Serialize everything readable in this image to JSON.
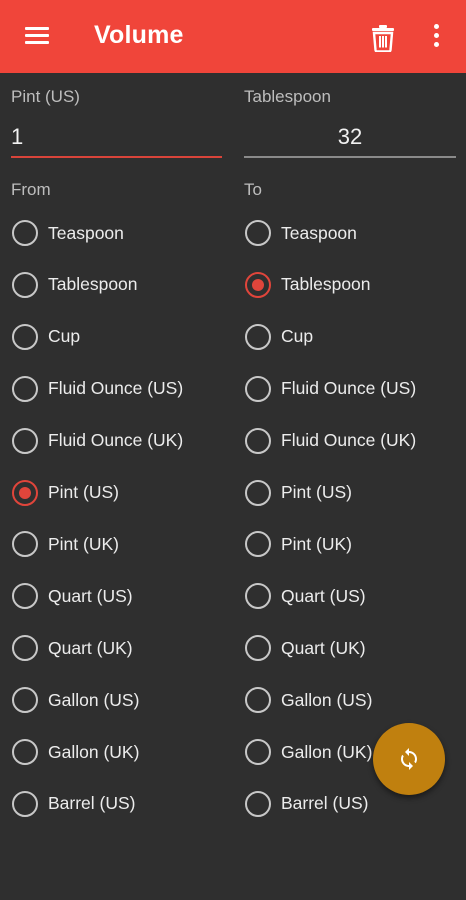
{
  "appbar": {
    "title": "Volume",
    "menu_icon": "menu-icon",
    "delete_icon": "trash-icon",
    "more_icon": "more-vert-icon"
  },
  "from_field": {
    "label": "Pint (US)",
    "value": "1"
  },
  "to_field": {
    "label": "Tablespoon",
    "value": "32"
  },
  "from_column": {
    "label": "From",
    "selected": "Pint (US)",
    "options": [
      "Teaspoon",
      "Tablespoon",
      "Cup",
      "Fluid Ounce (US)",
      "Fluid Ounce (UK)",
      "Pint (US)",
      "Pint (UK)",
      "Quart (US)",
      "Quart (UK)",
      "Gallon (US)",
      "Gallon (UK)",
      "Barrel (US)"
    ]
  },
  "to_column": {
    "label": "To",
    "selected": "Tablespoon",
    "options": [
      "Teaspoon",
      "Tablespoon",
      "Cup",
      "Fluid Ounce (US)",
      "Fluid Ounce (UK)",
      "Pint (US)",
      "Pint (UK)",
      "Quart (US)",
      "Quart (UK)",
      "Gallon (US)",
      "Gallon (UK)",
      "Barrel (US)"
    ]
  },
  "fab": {
    "icon": "swap-refresh-icon"
  },
  "colors": {
    "appbar": "#f0453a",
    "background": "#2f2f2f",
    "accent": "#e0453b",
    "fab": "#c0800f"
  }
}
